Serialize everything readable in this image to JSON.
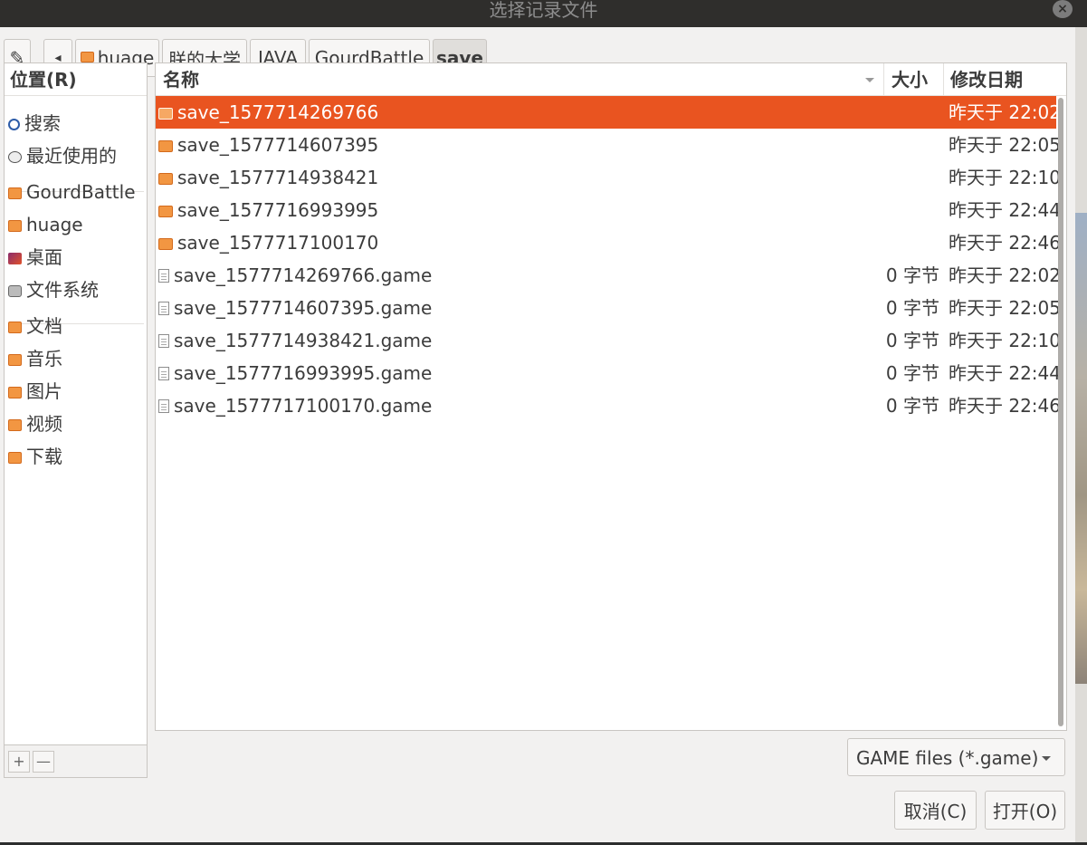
{
  "window": {
    "title": "选择记录文件",
    "close_glyph": "×"
  },
  "pathbar": {
    "edit_glyph": "✎",
    "back_glyph": "◂",
    "crumbs": [
      "huage",
      "朕的大学",
      "JAVA",
      "GourdBattle",
      "save"
    ]
  },
  "places": {
    "header": "位置(R)",
    "items": [
      {
        "label": "搜索",
        "icon": "search-icon"
      },
      {
        "label": "最近使用的",
        "icon": "recent-icon"
      },
      {
        "label": "GourdBattle",
        "icon": "folder-icon"
      },
      {
        "label": "huage",
        "icon": "folder-icon"
      },
      {
        "label": "桌面",
        "icon": "desktop-icon"
      },
      {
        "label": "文件系统",
        "icon": "drive-icon"
      },
      {
        "label": "文档",
        "icon": "folder-icon"
      },
      {
        "label": "音乐",
        "icon": "folder-icon"
      },
      {
        "label": "图片",
        "icon": "folder-icon"
      },
      {
        "label": "视频",
        "icon": "folder-icon"
      },
      {
        "label": "下载",
        "icon": "folder-icon"
      }
    ],
    "add_glyph": "+",
    "remove_glyph": "—"
  },
  "filelist": {
    "columns": {
      "name": "名称",
      "size": "大小",
      "date": "修改日期"
    },
    "rows": [
      {
        "name": "save_1577714269766",
        "size": "",
        "date": "昨天于 22:02",
        "type": "folder",
        "selected": true
      },
      {
        "name": "save_1577714607395",
        "size": "",
        "date": "昨天于 22:05",
        "type": "folder"
      },
      {
        "name": "save_1577714938421",
        "size": "",
        "date": "昨天于 22:10",
        "type": "folder"
      },
      {
        "name": "save_1577716993995",
        "size": "",
        "date": "昨天于 22:44",
        "type": "folder"
      },
      {
        "name": "save_1577717100170",
        "size": "",
        "date": "昨天于 22:46",
        "type": "folder"
      },
      {
        "name": "save_1577714269766.game",
        "size": "0 字节",
        "date": "昨天于 22:02",
        "type": "file"
      },
      {
        "name": "save_1577714607395.game",
        "size": "0 字节",
        "date": "昨天于 22:05",
        "type": "file"
      },
      {
        "name": "save_1577714938421.game",
        "size": "0 字节",
        "date": "昨天于 22:10",
        "type": "file"
      },
      {
        "name": "save_1577716993995.game",
        "size": "0 字节",
        "date": "昨天于 22:44",
        "type": "file"
      },
      {
        "name": "save_1577717100170.game",
        "size": "0 字节",
        "date": "昨天于 22:46",
        "type": "file"
      }
    ]
  },
  "filter": {
    "selected": "GAME files (*.game)"
  },
  "actions": {
    "cancel": "取消(C)",
    "open": "打开(O)"
  },
  "colors": {
    "selection": "#e95420",
    "folder": "#f29642"
  }
}
